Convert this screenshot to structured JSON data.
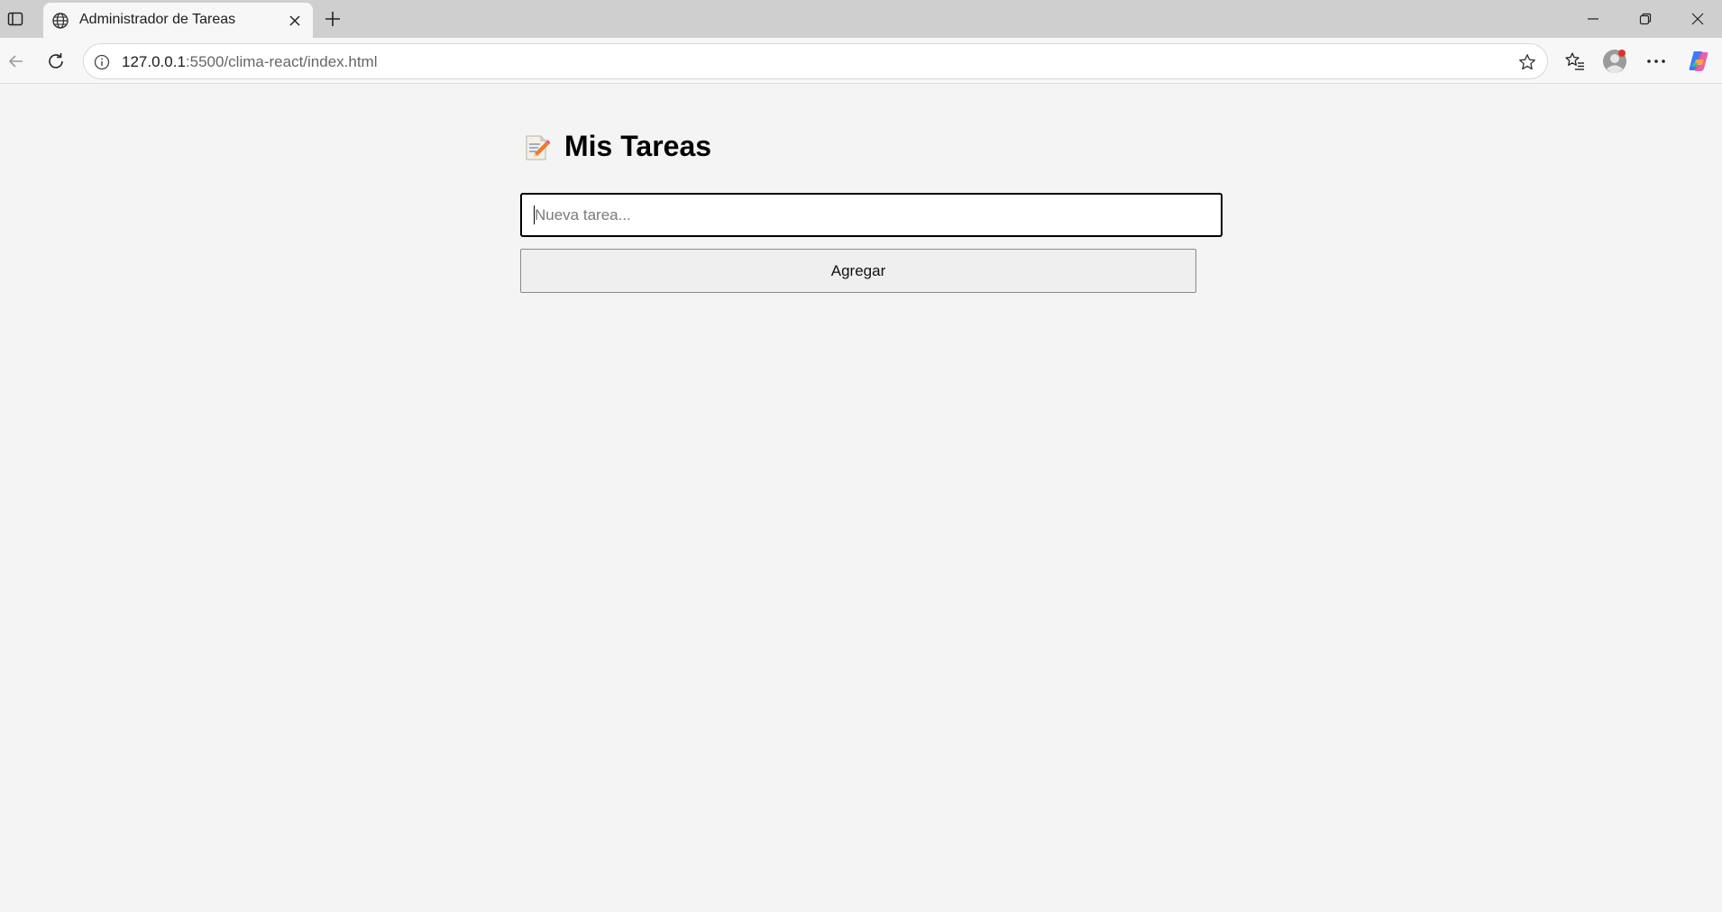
{
  "browser": {
    "tab": {
      "title": "Administrador de Tareas",
      "icon": "globe-icon"
    },
    "address": {
      "host": "127.0.0.1",
      "rest": ":5500/clima-react/index.html"
    },
    "profile_badge_color": "#e0312a"
  },
  "page": {
    "title_emoji": "memo-icon",
    "title": "Mis Tareas",
    "input_placeholder": "Nueva tarea...",
    "input_value": "",
    "add_button_label": "Agregar",
    "background": "#f4f4f4"
  }
}
